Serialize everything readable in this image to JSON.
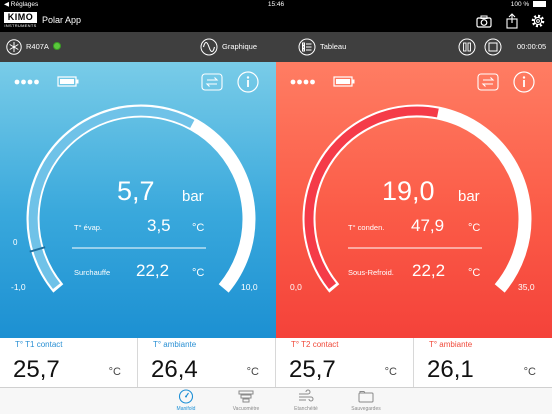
{
  "status_bar": {
    "back_label": "◀ Réglages",
    "time": "15:46",
    "battery": "100 %"
  },
  "app": {
    "logo_text": "KIMO",
    "logo_sub": "INSTRUMENTS",
    "title": "Polar App"
  },
  "toolbar": {
    "refrigerant": "R407A",
    "graph_label": "Graphique",
    "table_label": "Tableau",
    "timer": "00:00:05"
  },
  "left_panel": {
    "pressure": "5,7",
    "pressure_unit": "bar",
    "temp_label": "T° évap.",
    "temp_value": "3,5",
    "temp_unit": "°C",
    "sub_label": "Surchauffe",
    "sub_value": "22,2",
    "sub_unit": "°C",
    "zero_label": "0",
    "min_label": "-1,0",
    "max_label": "10,0",
    "gauge": {
      "min": -1.0,
      "max": 10.0,
      "value": 5.7
    }
  },
  "right_panel": {
    "pressure": "19,0",
    "pressure_unit": "bar",
    "temp_label": "T° conden.",
    "temp_value": "47,9",
    "temp_unit": "°C",
    "sub_label": "Sous-Refroid.",
    "sub_value": "22,2",
    "sub_unit": "°C",
    "min_label": "0,0",
    "max_label": "35,0",
    "gauge": {
      "min": 0.0,
      "max": 35.0,
      "value": 19.0
    }
  },
  "values": [
    {
      "label": "T° T1 contact",
      "value": "25,7",
      "unit": "°C",
      "color": "#2a90d4"
    },
    {
      "label": "T° ambiante",
      "value": "26,4",
      "unit": "°C",
      "color": "#2a90d4"
    },
    {
      "label": "T° T2 contact",
      "value": "25,7",
      "unit": "°C",
      "color": "#f04a3a"
    },
    {
      "label": "T° ambiante",
      "value": "26,1",
      "unit": "°C",
      "color": "#f04a3a"
    }
  ],
  "tabs": [
    {
      "label": "Manifold",
      "icon": "gauge-icon",
      "active": true
    },
    {
      "label": "Vacuomètre",
      "icon": "vacuum-icon",
      "active": false
    },
    {
      "label": "Etanchéité",
      "icon": "wind-icon",
      "active": false
    },
    {
      "label": "Sauvegardes",
      "icon": "folder-icon",
      "active": false
    }
  ],
  "colors": {
    "blue_accent": "#1c90d2",
    "red_accent": "#f4423a",
    "tab_active": "#1e90d6"
  }
}
